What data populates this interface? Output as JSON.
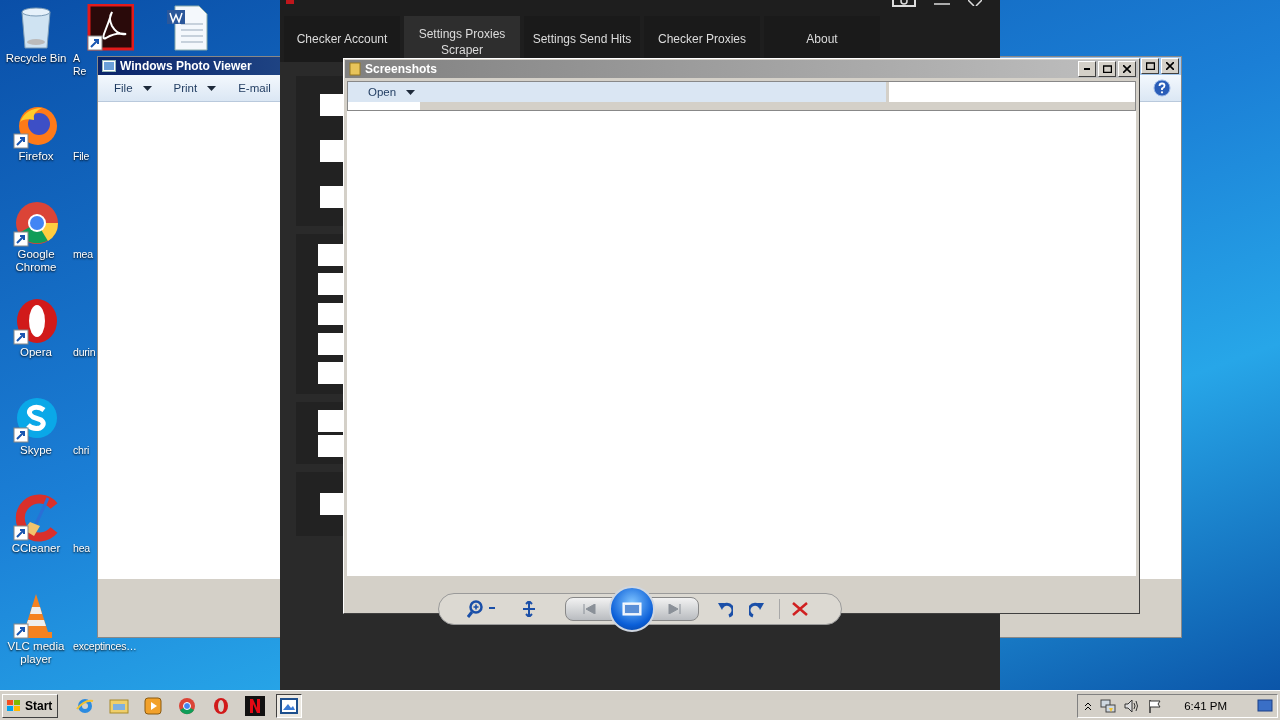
{
  "desktop": {
    "column_1": [
      {
        "kind": "recycle",
        "lines": [
          "Recycle Bin"
        ]
      },
      {
        "kind": "firefox",
        "lines": [
          "Firefox"
        ]
      },
      {
        "kind": "chrome",
        "lines": [
          "Google",
          "Chrome"
        ]
      },
      {
        "kind": "opera",
        "lines": [
          "Opera"
        ]
      },
      {
        "kind": "skype",
        "lines": [
          "Skype"
        ]
      },
      {
        "kind": "ccleaner",
        "lines": [
          "CCleaner"
        ]
      },
      {
        "kind": "vlc",
        "lines": [
          "VLC media",
          "player"
        ]
      }
    ],
    "column_2": [
      {
        "kind": "acrobat",
        "lines": [
          "A",
          "Re"
        ]
      },
      {
        "lines": [
          "File"
        ]
      },
      {
        "lines": [
          "mea"
        ]
      },
      {
        "lines": [
          "durin"
        ]
      },
      {
        "lines": [
          "chri"
        ]
      },
      {
        "lines": [
          "hea"
        ]
      },
      {
        "lines": [
          "exceptinces…"
        ]
      }
    ],
    "column_3": [
      {
        "kind": "word"
      }
    ]
  },
  "checker_window": {
    "tabs": [
      {
        "label": "Checker Account",
        "selected": false
      },
      {
        "label": "Settings Proxies Scraper",
        "selected": true
      },
      {
        "label": "Settings Send Hits",
        "selected": false
      },
      {
        "label": "Checker Proxies",
        "selected": false
      },
      {
        "label": "About",
        "selected": false
      }
    ]
  },
  "photo_viewer": {
    "title": "Windows Photo Viewer",
    "menu": [
      {
        "kind": "dropdown",
        "label": "File"
      },
      {
        "kind": "dropdown",
        "label": "Print"
      },
      {
        "kind": "plain",
        "label": "E-mail"
      }
    ]
  },
  "folder_window": {
    "title": "Screenshots",
    "toolbar": [
      {
        "kind": "dropdown",
        "label": "Open"
      }
    ]
  },
  "taskbar": {
    "start": "Start",
    "apps": [
      {
        "kind": "ie",
        "selected": false
      },
      {
        "kind": "explorer",
        "selected": false
      },
      {
        "kind": "media",
        "selected": false
      },
      {
        "kind": "chrome",
        "selected": false
      },
      {
        "kind": "opera",
        "selected": false
      },
      {
        "kind": "netflix",
        "selected": false
      },
      {
        "kind": "photos",
        "selected": true
      }
    ],
    "clock": "6:41 PM"
  }
}
